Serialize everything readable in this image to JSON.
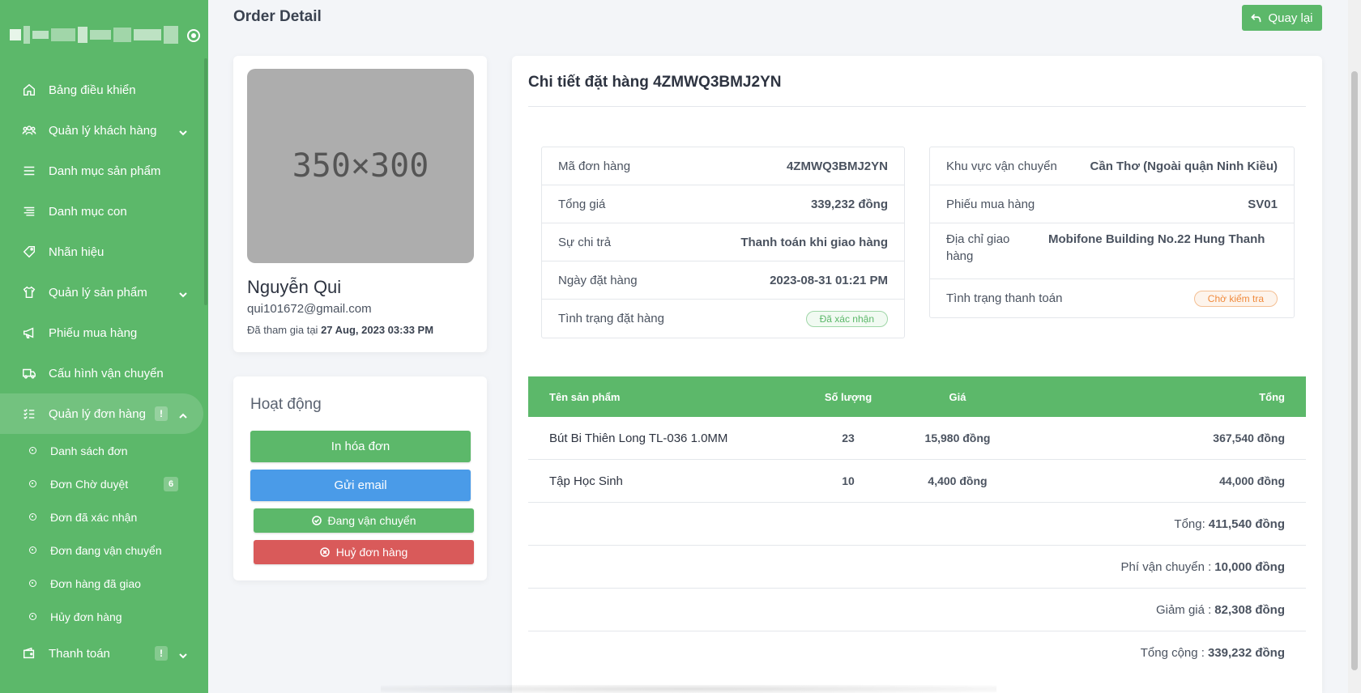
{
  "sidebar": {
    "items": [
      {
        "label": "Bảng điều khiển",
        "icon": "home-icon"
      },
      {
        "label": "Quản lý khách hàng",
        "icon": "users-icon"
      },
      {
        "label": "Danh mục sản phẩm",
        "icon": "list-icon"
      },
      {
        "label": "Danh mục con",
        "icon": "sublist-icon"
      },
      {
        "label": "Nhãn hiệu",
        "icon": "tag-icon"
      },
      {
        "label": "Quản lý sản phẩm",
        "icon": "shirt-icon"
      },
      {
        "label": "Phiếu mua hàng",
        "icon": "megaphone-icon"
      },
      {
        "label": "Cấu hình vận chuyển",
        "icon": "truck-icon"
      },
      {
        "label": "Quản lý đơn hàng",
        "icon": "checklist-icon",
        "alert": "!"
      },
      {
        "label": "Thanh toán",
        "icon": "wallet-icon",
        "alert": "!"
      }
    ],
    "order_sub": [
      {
        "label": "Danh sách đơn"
      },
      {
        "label": "Đơn Chờ duyệt",
        "badge": "6"
      },
      {
        "label": "Đơn đã xác nhận"
      },
      {
        "label": "Đơn đang vận chuyển"
      },
      {
        "label": "Đơn hàng đã giao"
      },
      {
        "label": "Hủy đơn hàng"
      }
    ]
  },
  "header": {
    "title": "Order Detail",
    "back_label": "Quay lại"
  },
  "profile": {
    "placeholder": "350×300",
    "name": "Nguyễn Qui",
    "email": "qui101672@gmail.com",
    "joined_prefix": "Đã tham gia tại",
    "joined_date": "27 Aug, 2023 03:33 PM"
  },
  "activity": {
    "title": "Hoạt động",
    "print_label": "In hóa đơn",
    "email_label": "Gửi email",
    "ship_label": "Đang vận chuyển",
    "cancel_label": "Huỷ đơn hàng"
  },
  "order": {
    "title": "Chi tiết đặt hàng 4ZMWQ3BMJ2YN",
    "left": {
      "code_label": "Mã đơn hàng",
      "code": "4ZMWQ3BMJ2YN",
      "total_label": "Tổng giá",
      "total": "339,232 đồng",
      "payment_label": "Sự chi trả",
      "payment": "Thanh toán khi giao hàng",
      "date_label": "Ngày đặt hàng",
      "date": "2023-08-31 01:21 PM",
      "status_label": "Tình trạng đặt hàng",
      "status": "Đã xác nhận"
    },
    "right": {
      "region_label": "Khu vực vận chuyển",
      "region": "Cần Thơ (Ngoài quận Ninh Kiều)",
      "voucher_label": "Phiếu mua hàng",
      "voucher": "SV01",
      "address_label": "Địa chỉ giao hàng",
      "address": "Mobifone Building No.22 Hung Thanh",
      "pay_status_label": "Tình trạng thanh toán",
      "pay_status": "Chờ kiểm tra"
    },
    "table": {
      "headers": {
        "name": "Tên sản phẩm",
        "qty": "Số lượng",
        "price": "Giá",
        "total": "Tổng"
      },
      "rows": [
        {
          "name": "Bút Bi Thiên Long TL-036 1.0MM",
          "qty": "23",
          "price": "15,980 đồng",
          "total": "367,540 đồng"
        },
        {
          "name": "Tập Học Sinh",
          "qty": "10",
          "price": "4,400 đồng",
          "total": "44,000 đồng"
        }
      ]
    },
    "summary": {
      "subtotal_label": "Tổng:",
      "subtotal": "411,540 đồng",
      "shipping_label": "Phí vận chuyển :",
      "shipping": "10,000 đồng",
      "discount_label": "Giảm giá :",
      "discount": "82,308 đồng",
      "grand_label": "Tổng cộng :",
      "grand": "339,232 đồng"
    }
  },
  "colors": {
    "accent": "#5cb86a",
    "blue": "#4a9be8",
    "red": "#d95a5a",
    "orange": "#f08a3c"
  }
}
